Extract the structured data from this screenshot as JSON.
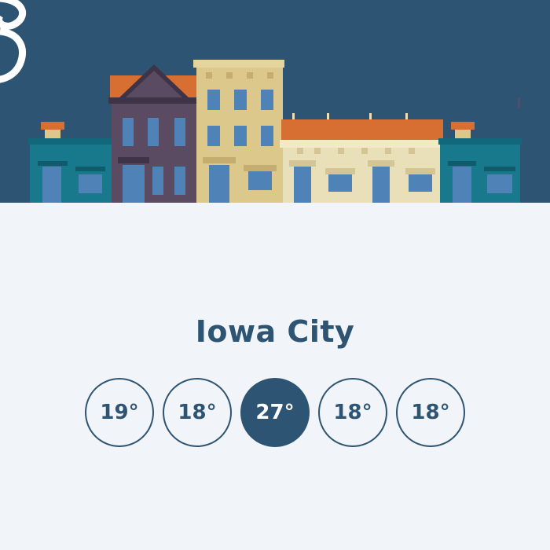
{
  "city": {
    "name": "Iowa City"
  },
  "forecast": [
    {
      "temp": "19°",
      "selected": false
    },
    {
      "temp": "18°",
      "selected": false
    },
    {
      "temp": "27°",
      "selected": true
    },
    {
      "temp": "18°",
      "selected": false
    },
    {
      "temp": "18°",
      "selected": false
    }
  ],
  "colors": {
    "sky": "#2d5472",
    "background": "#f1f4f8",
    "accent": "#2d5472",
    "roof": "#d86f32",
    "teal": "#17798b",
    "purple": "#5a4b63",
    "yellow": "#dcc88a",
    "cream": "#e9dfb9",
    "window": "#4f83b7"
  },
  "icons": {
    "logo": "swirl-logo-icon"
  }
}
